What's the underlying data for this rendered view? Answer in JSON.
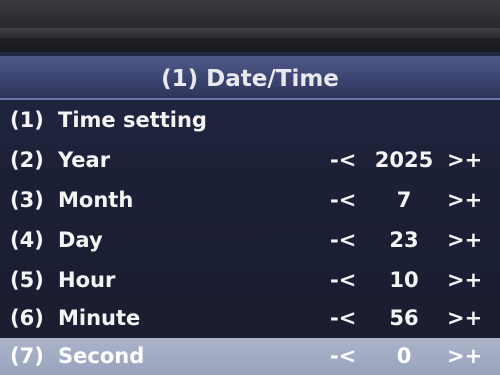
{
  "header": {
    "title": "(1) Date/Time"
  },
  "rows": [
    {
      "num": "(1)",
      "label": "Time setting",
      "dec": "",
      "value": "",
      "inc": ""
    },
    {
      "num": "(2)",
      "label": "Year",
      "dec": "-<",
      "value": "2025",
      "inc": ">+"
    },
    {
      "num": "(3)",
      "label": "Month",
      "dec": "-<",
      "value": "7",
      "inc": ">+"
    },
    {
      "num": "(4)",
      "label": "Day",
      "dec": "-<",
      "value": "23",
      "inc": ">+"
    },
    {
      "num": "(5)",
      "label": "Hour",
      "dec": "-<",
      "value": "10",
      "inc": ">+"
    },
    {
      "num": "(6)",
      "label": "Minute",
      "dec": "-<",
      "value": "56",
      "inc": ">+"
    },
    {
      "num": "(7)",
      "label": "Second",
      "dec": "-<",
      "value": "0",
      "inc": ">+"
    }
  ],
  "selected_row": 7
}
